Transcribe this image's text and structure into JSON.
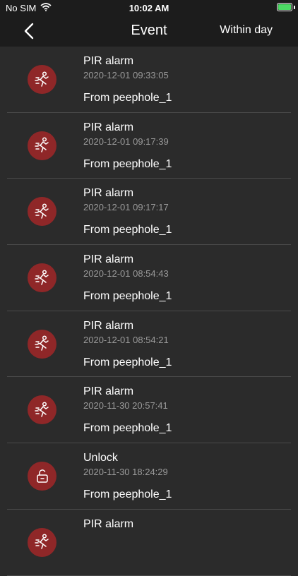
{
  "status_bar": {
    "carrier": "No SIM",
    "time": "10:02 AM",
    "battery_color": "#4cd964"
  },
  "nav": {
    "title": "Event",
    "right_label": "Within day",
    "back_icon": "chevron-left-icon"
  },
  "events": [
    {
      "icon": "running-person-icon",
      "title": "PIR alarm",
      "time": "2020-12-01 09:33:05",
      "source": "From peephole_1"
    },
    {
      "icon": "running-person-icon",
      "title": "PIR alarm",
      "time": "2020-12-01 09:17:39",
      "source": "From peephole_1"
    },
    {
      "icon": "running-person-icon",
      "title": "PIR alarm",
      "time": "2020-12-01 09:17:17",
      "source": "From peephole_1"
    },
    {
      "icon": "running-person-icon",
      "title": "PIR alarm",
      "time": "2020-12-01 08:54:43",
      "source": "From peephole_1"
    },
    {
      "icon": "running-person-icon",
      "title": "PIR alarm",
      "time": "2020-12-01 08:54:21",
      "source": "From peephole_1"
    },
    {
      "icon": "running-person-icon",
      "title": "PIR alarm",
      "time": "2020-11-30 20:57:41",
      "source": "From peephole_1"
    },
    {
      "icon": "unlock-icon",
      "title": "Unlock",
      "time": "2020-11-30 18:24:29",
      "source": "From peephole_1"
    },
    {
      "icon": "running-person-icon",
      "title": "PIR alarm",
      "time": "",
      "source": ""
    }
  ],
  "colors": {
    "background": "#2b2b2b",
    "bar": "#1c1c1c",
    "icon_bg": "#8f2728",
    "divider": "#4a4a4a"
  }
}
